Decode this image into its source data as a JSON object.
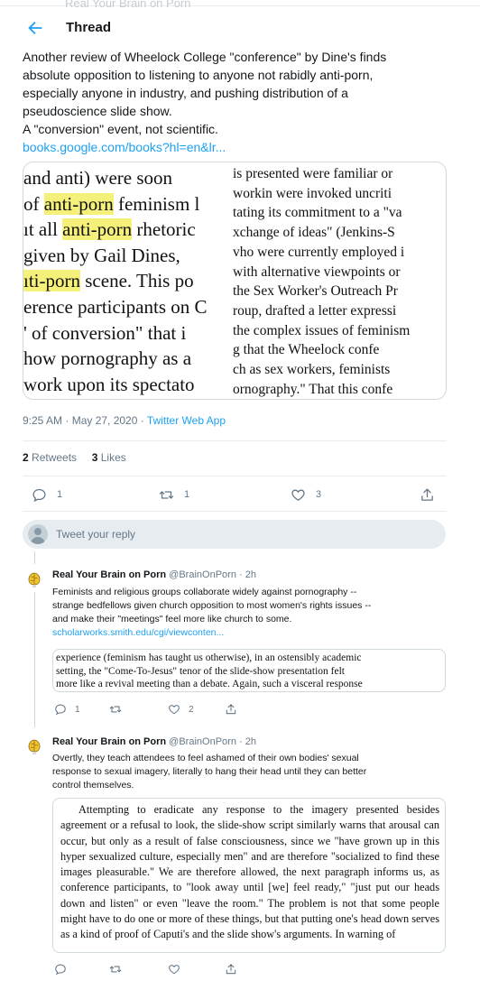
{
  "header": {
    "faded_title": "Real Your Brain on Porn",
    "title": "Thread"
  },
  "main_tweet": {
    "text_line1": "Another review of Wheelock College \"conference\" by Dine's finds",
    "text_line2": "absolute opposition to listening to anyone not rabidly anti-porn,",
    "text_line3": "especially anyone in industry, and pushing distribution of a",
    "text_line4": "pseudoscience slide show.",
    "text_line5": "A \"conversion\" event, not scientific.",
    "link": "books.google.com/books?hl=en&lr...",
    "scan_left": [
      {
        "a": "and anti) were soon",
        "hl": "",
        "b": ""
      },
      {
        "a": "of ",
        "hl": "anti-porn",
        "b": " feminism l"
      },
      {
        "a": "ıt all ",
        "hl": "anti-porn",
        "b": " rhetoric"
      },
      {
        "a": "given by Gail Dines,",
        "hl": "",
        "b": ""
      },
      {
        "a": "",
        "hl": "ıti-porn",
        "b": " scene. This po"
      },
      {
        "a": "erence participants on C",
        "hl": "",
        "b": ""
      },
      {
        "a": "' of conversion\" that i",
        "hl": "",
        "b": ""
      },
      {
        "a": " how pornography as a",
        "hl": "",
        "b": ""
      },
      {
        "a": " work upon its spectato",
        "hl": "",
        "b": ""
      }
    ],
    "scan_right": [
      "is presented were familiar or",
      "workin were invoked uncriti",
      "tating its commitment to a \"va",
      "xchange of ideas\" (Jenkins-S",
      "vho were currently employed i",
      "with alternative viewpoints or",
      "the Sex Worker's Outreach Pr",
      "roup, drafted a letter expressi",
      "the complex issues of feminism",
      "g that the Wheelock confe",
      "ch as sex workers, feminists",
      "ornography.\" That this confe"
    ],
    "timestamp": "9:25 AM · May 27, 2020 · ",
    "source": "Twitter Web App",
    "retweets_count": "2",
    "retweets_label": " Retweets",
    "likes_count": "3",
    "likes_label": " Likes",
    "reply_count": "1",
    "retweet_count": "1",
    "like_count": "3"
  },
  "reply_box": {
    "placeholder": "Tweet your reply"
  },
  "replies": [
    {
      "name": "Real Your Brain on Porn",
      "handle": " @BrainOnPorn · 2h",
      "line1": "Feminists and religious groups collaborate widely against pornography --",
      "line2": "strange bedfellows given church opposition to most women's rights issues --",
      "line3": "and make their \"meetings\" feel more like church to some.",
      "link": "scholarworks.smith.edu/cgi/viewconten...",
      "image_lines": [
        "experience (feminism has taught us otherwise), in an ostensibly academic",
        "setting, the \"Come-To-Jesus\" tenor of the slide-show presentation felt",
        "more like a revival meeting than a debate. Again, such a visceral response"
      ],
      "reply_count": "1",
      "retweet_count": "",
      "like_count": "2"
    },
    {
      "name": "Real Your Brain on Porn",
      "handle": " @BrainOnPorn · 2h",
      "line1": "Overtly, they teach attendees to feel ashamed of their own bodies' sexual",
      "line2": "response to sexual imagery, literally to hang their head until they can better",
      "line3": "control themselves.",
      "image_text": "Attempting to eradicate any response to the imagery presented besides agreement or a refusal to look, the slide-show script similarly warns that arousal can occur, but only as a result of false consciousness, since we \"have grown up in this hyper sexualized culture, especially men\" and are therefore \"socialized to find these images pleasurable.\" We are therefore allowed, the next paragraph informs us, as conference participants, to \"look away until [we] feel ready,\" \"just put our heads down and listen\" or even \"leave the room.\" The problem is not that some people might have to do one or more of these things, but that putting one's head down serves as a kind of proof of Caputi's and the slide show's arguments. In warning of",
      "reply_count": "",
      "retweet_count": "",
      "like_count": ""
    }
  ],
  "colors": {
    "accent": "#1da1f2",
    "muted": "#657786",
    "highlight": "#f5f07a",
    "avatar_yellow": "#f2c230"
  }
}
